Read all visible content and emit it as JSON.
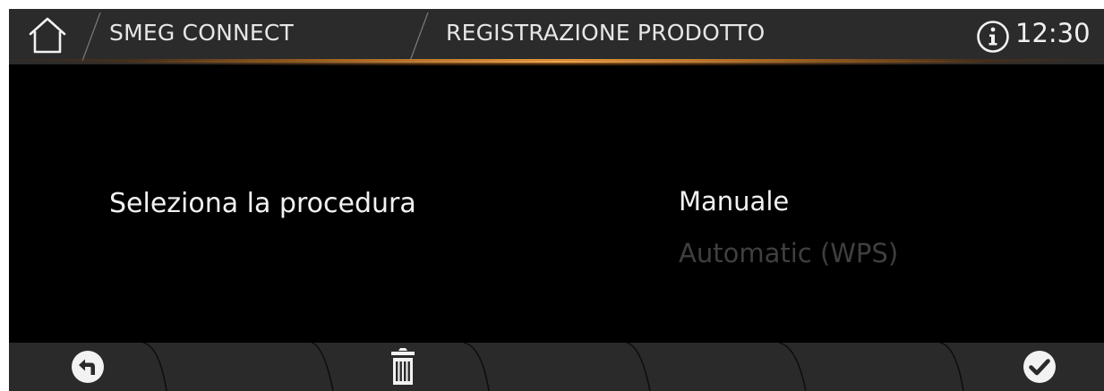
{
  "header": {
    "breadcrumb_app": "SMEG CONNECT",
    "breadcrumb_page": "REGISTRAZIONE PRODOTTO",
    "clock": "12:30"
  },
  "main": {
    "prompt": "Seleziona la procedura",
    "options": [
      {
        "label": "Manuale",
        "state": "selected"
      },
      {
        "label": "Automatic (WPS)",
        "state": "disabled"
      }
    ]
  },
  "footer": {
    "buttons": [
      "back-icon",
      "trash-icon",
      "check-icon"
    ]
  },
  "colors": {
    "background": "#000000",
    "bar": "#2b2b2b",
    "accent": "#f3a44e",
    "text": "#f2f2f2",
    "text_disabled": "#3f3f3f"
  }
}
